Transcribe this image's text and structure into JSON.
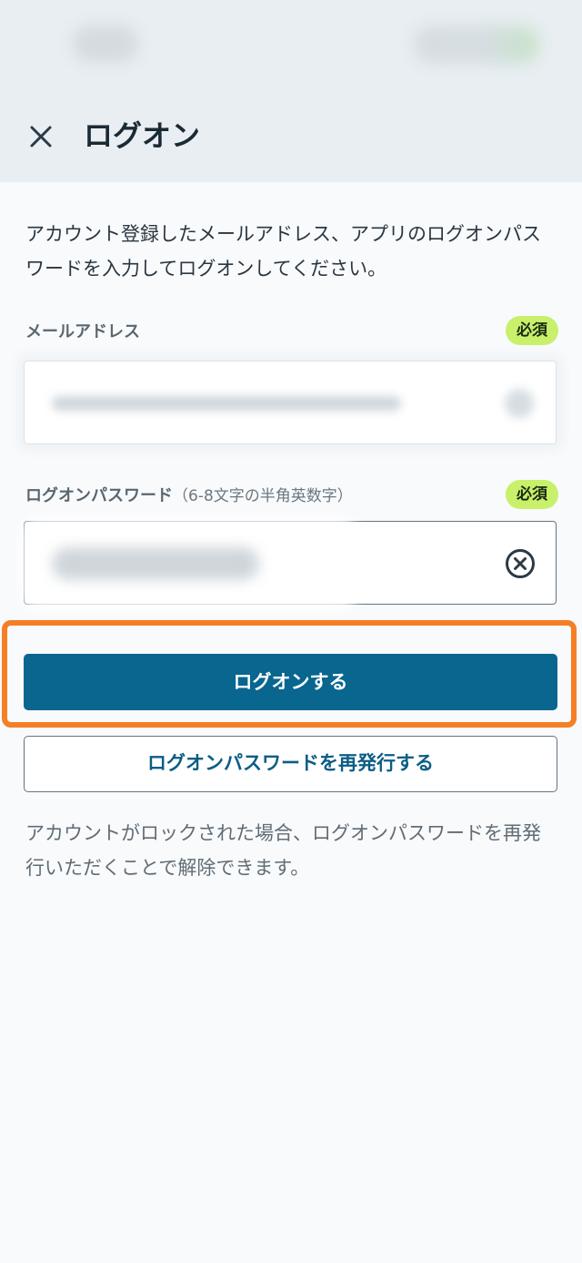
{
  "header": {
    "title": "ログオン",
    "close_icon": "close-icon"
  },
  "intro_text": "アカウント登録したメールアドレス、アプリのログオンパスワードを入力してログオンしてください。",
  "email_field": {
    "label": "メールアドレス",
    "required_badge": "必須"
  },
  "password_field": {
    "label": "ログオンパスワード",
    "hint": "（6-8文字の半角英数字）",
    "required_badge": "必須",
    "clear_icon": "clear-circle-icon"
  },
  "buttons": {
    "login_label": "ログオンする",
    "reissue_label": "ログオンパスワードを再発行する"
  },
  "note_text": "アカウントがロックされた場合、ログオンパスワードを再発行いただくことで解除できます。",
  "colors": {
    "primary": "#08668f",
    "badge": "#c8f06a",
    "highlight": "#f57f25",
    "header_bg": "#e8eef2"
  }
}
